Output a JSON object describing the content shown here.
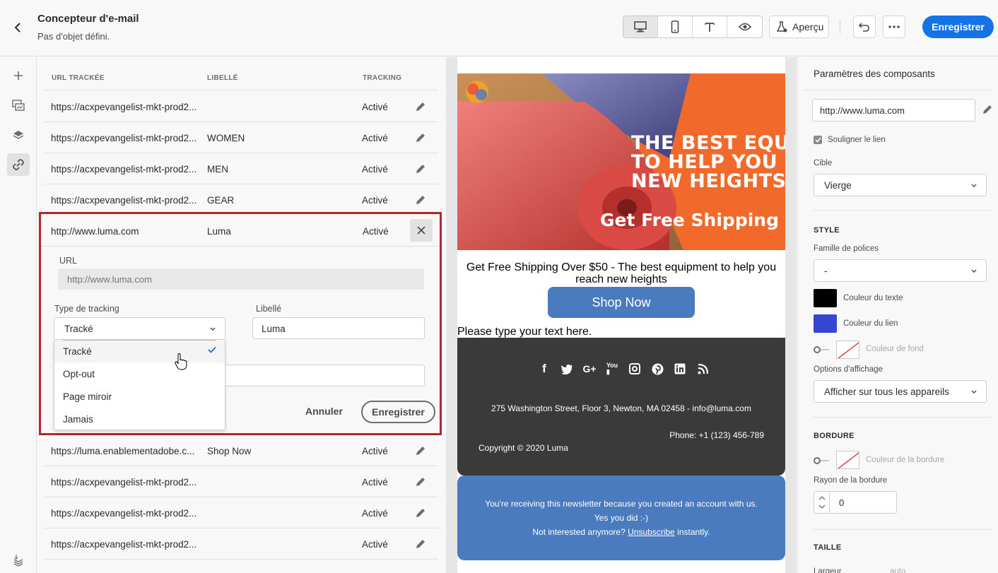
{
  "header": {
    "title": "Concepteur d'e-mail",
    "subtitle": "Pas d'objet défini.",
    "apercu_label": "Aperçu",
    "save_label": "Enregistrer"
  },
  "links_table": {
    "col_url": "URL TRACKÉE",
    "col_label": "LIBELLÉ",
    "col_tracking": "TRACKING",
    "rows_top": [
      {
        "url": "https://acxpevangelist-mkt-prod2...",
        "label": "",
        "tracking": "Activé"
      },
      {
        "url": "https://acxpevangelist-mkt-prod2...",
        "label": "WOMEN",
        "tracking": "Activé"
      },
      {
        "url": "https://acxpevangelist-mkt-prod2...",
        "label": "MEN",
        "tracking": "Activé"
      },
      {
        "url": "https://acxpevangelist-mkt-prod2...",
        "label": "GEAR",
        "tracking": "Activé"
      }
    ],
    "editing": {
      "url": "http://www.luma.com",
      "label": "Luma",
      "tracking": "Activé",
      "url_field_label": "URL",
      "url_placeholder": "http://www.luma.com",
      "tracking_type_label": "Type de tracking",
      "tracking_type_value": "Tracké",
      "libelle_label": "Libellé",
      "libelle_value": "Luma",
      "options": [
        "Tracké",
        "Opt-out",
        "Page miroir",
        "Jamais"
      ],
      "cancel_label": "Annuler",
      "save_label": "Enregistrer"
    },
    "rows_bottom": [
      {
        "url": "https://luma.enablementadobe.c...",
        "label": "Shop Now",
        "tracking": "Activé"
      },
      {
        "url": "https://acxpevangelist-mkt-prod2...",
        "label": "",
        "tracking": "Activé"
      },
      {
        "url": "https://acxpevangelist-mkt-prod2...",
        "label": "",
        "tracking": "Activé"
      },
      {
        "url": "https://acxpevangelist-mkt-prod2...",
        "label": "",
        "tracking": "Activé"
      }
    ]
  },
  "email": {
    "hero_line1": "THE BEST EQUIPM",
    "hero_line2": "TO HELP YOU REA",
    "hero_line3": "NEW HEIGHTS",
    "hero_shipping": "Get Free Shipping ove",
    "promo_text": "Get Free Shipping Over $50 - The best equipment to help you reach new heights",
    "shop_button": "Shop Now",
    "placeholder_text": "Please type your text here.",
    "address": "275 Washington Street, Floor 3, Newton, MA 02458 - info@luma.com",
    "phone": "Phone: +1 (123) 456-789",
    "copyright": "Copyright © 2020 Luma",
    "newsletter_line1": "You're receiving this newsletter because you created an account with us.",
    "newsletter_line2": "Yes you did :-)",
    "newsletter_line3_pre": "Not interested anymore?",
    "unsubscribe": "Unsubscribe",
    "newsletter_line3_post": "instantly."
  },
  "right_panel": {
    "title": "Paramètres des composants",
    "link_value": "http://www.luma.com",
    "underline_label": "Souligner le lien",
    "target_label": "Cible",
    "target_value": "Vierge",
    "style_heading": "STYLE",
    "font_family_label": "Famille de polices",
    "font_family_value": "-",
    "text_color_label": "Couleur du texte",
    "link_color_label": "Couleur du lien",
    "bg_color_label": "Couleur de fond",
    "display_options_label": "Options d'affichage",
    "display_options_value": "Afficher sur tous les appareils",
    "border_heading": "BORDURE",
    "border_color_label": "Couleur de la bordure",
    "border_radius_label": "Rayon de la bordure",
    "border_radius_value": "0",
    "size_heading": "TAILLE",
    "size_partial_label": "Largeur",
    "size_partial_value": "auto"
  },
  "colors": {
    "accent": "#1473e6",
    "highlight_border": "#b0282b",
    "text_color": "#000000",
    "link_color": "#3347d1",
    "email_dark": "#3a3a3a",
    "email_blue": "#4a7bbe"
  }
}
